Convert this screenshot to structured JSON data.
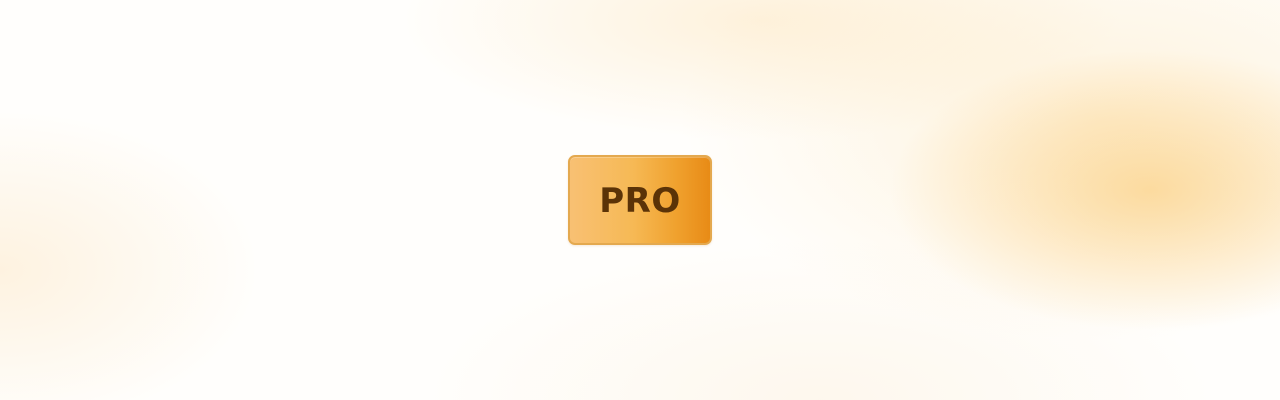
{
  "badge": {
    "label": "PRO",
    "colors": {
      "fill_start": "#f8c073",
      "fill_end": "#e88b16",
      "border": "#e4a94f",
      "text": "#5b3307"
    }
  },
  "background": {
    "base": "#fffefc",
    "glow": "#fac464"
  }
}
